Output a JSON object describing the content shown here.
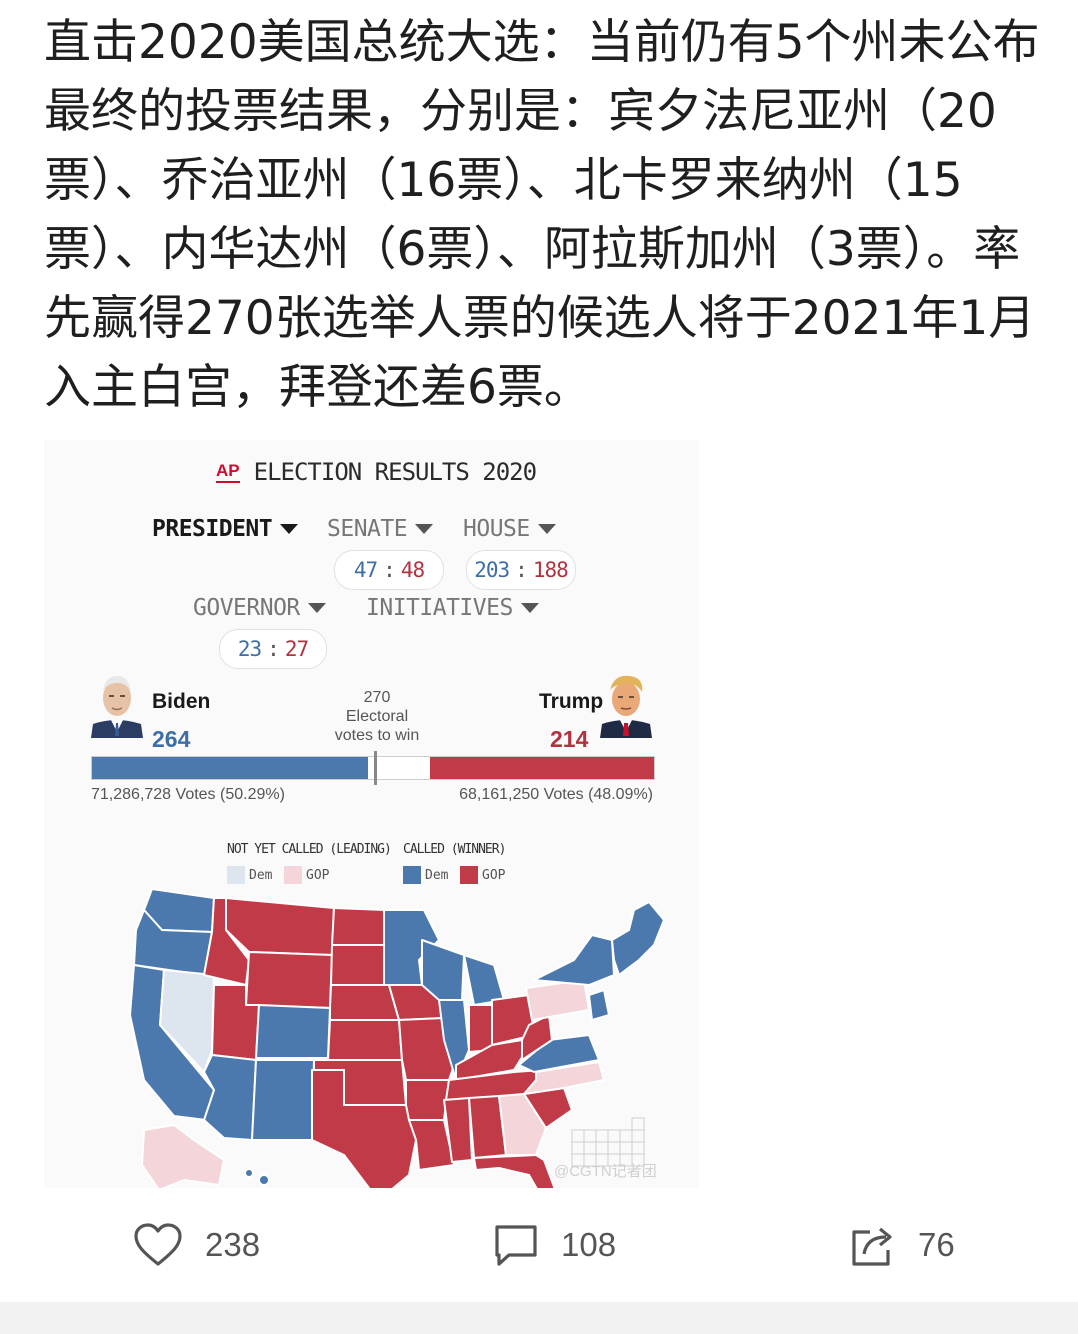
{
  "post": {
    "text": "直击2020美国总统大选：当前仍有5个州未公布最终的投票结果，分别是：宾夕法尼亚州（20票）、乔治亚州（16票）、北卡罗来纳州（15票）、内华达州（6票）、阿拉斯加州（3票）。率先赢得270张选举人票的候选人将于2021年1月入主白宫，拜登还差6票。"
  },
  "card": {
    "logo": "AP",
    "title": "ELECTION RESULTS 2020",
    "tabs": {
      "president": "PRESIDENT",
      "senate": "SENATE",
      "house": "HOUSE",
      "governor": "GOVERNOR",
      "initiatives": "INITIATIVES"
    },
    "senate": {
      "dem": "47",
      "gop": "48"
    },
    "house": {
      "dem": "203",
      "gop": "188"
    },
    "governor": {
      "dem": "23",
      "gop": "27"
    },
    "separator": ":",
    "biden": {
      "name": "Biden",
      "electoral": "264",
      "popular": "71,286,728 Votes (50.29%)"
    },
    "trump": {
      "name": "Trump",
      "electoral": "214",
      "popular": "68,161,250 Votes (48.09%)"
    },
    "threshold": {
      "number": "270",
      "line1": "Electoral",
      "line2": "votes to win"
    },
    "bar": {
      "total": 538,
      "dem": 264,
      "gop": 214
    },
    "legend": {
      "not_called": "NOT YET CALLED (LEADING)",
      "called": "CALLED (WINNER)",
      "dem": "Dem",
      "gop": "GOP"
    },
    "watermark": "@CGTN记者团"
  },
  "colors": {
    "dem_called": "#4c79ad",
    "gop_called": "#c13a48",
    "dem_leading": "#dde5ef",
    "gop_leading": "#f4d6da"
  },
  "actions": {
    "likes": "238",
    "comments": "108",
    "shares": "76"
  }
}
